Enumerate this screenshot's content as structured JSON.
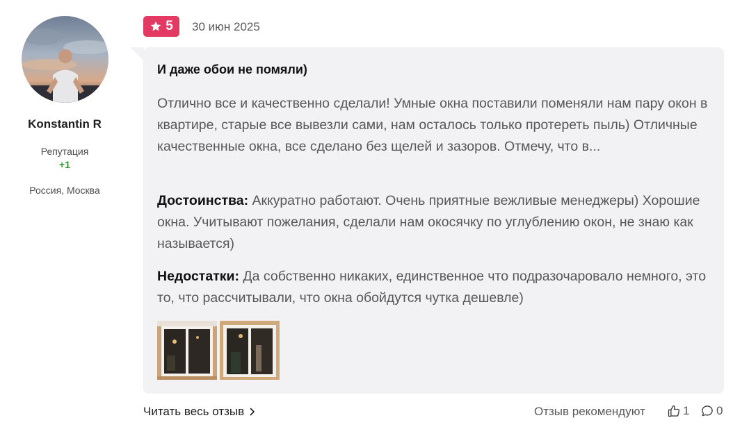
{
  "author": {
    "name": "Konstantin R",
    "reputation_label": "Репутация",
    "reputation_value": "+1",
    "location": "Россия, Москва",
    "avatar_icon": "user-photo"
  },
  "review": {
    "rating": "5",
    "rating_icon": "star-icon",
    "date": "30 июн 2025",
    "title": "И даже обои не помяли)",
    "text": "Отлично все и качественно сделали! Умные окна поставили поменяли нам пару окон в квартире, старые все вывезли сами, нам осталось только протереть пыль) Отличные качественные окна, все сделано без щелей и зазоров. Отмечу, что в...",
    "pros_label": "Достоинства:",
    "pros_text": "Аккуратно работают. Очень приятные вежливые менеджеры) Хорошие окна. Учитывают пожелания, сделали нам окосячку по углублению окон, не знаю как называется)",
    "cons_label": "Недостатки:",
    "cons_text": "Да собственно никаких, единственное что подразочаровало немного, это то, что рассчитывали, что окна обойдутся чутка дешевле)",
    "photos": [
      "window-photo-1",
      "window-photo-2"
    ]
  },
  "footer": {
    "read_more": "Читать весь отзыв",
    "recommend_label": "Отзыв рекомендуют",
    "likes": "1",
    "comments": "0"
  },
  "colors": {
    "accent": "#e23a63",
    "reputation": "#2e9b2e",
    "bubble_bg": "#f2f2f4"
  }
}
